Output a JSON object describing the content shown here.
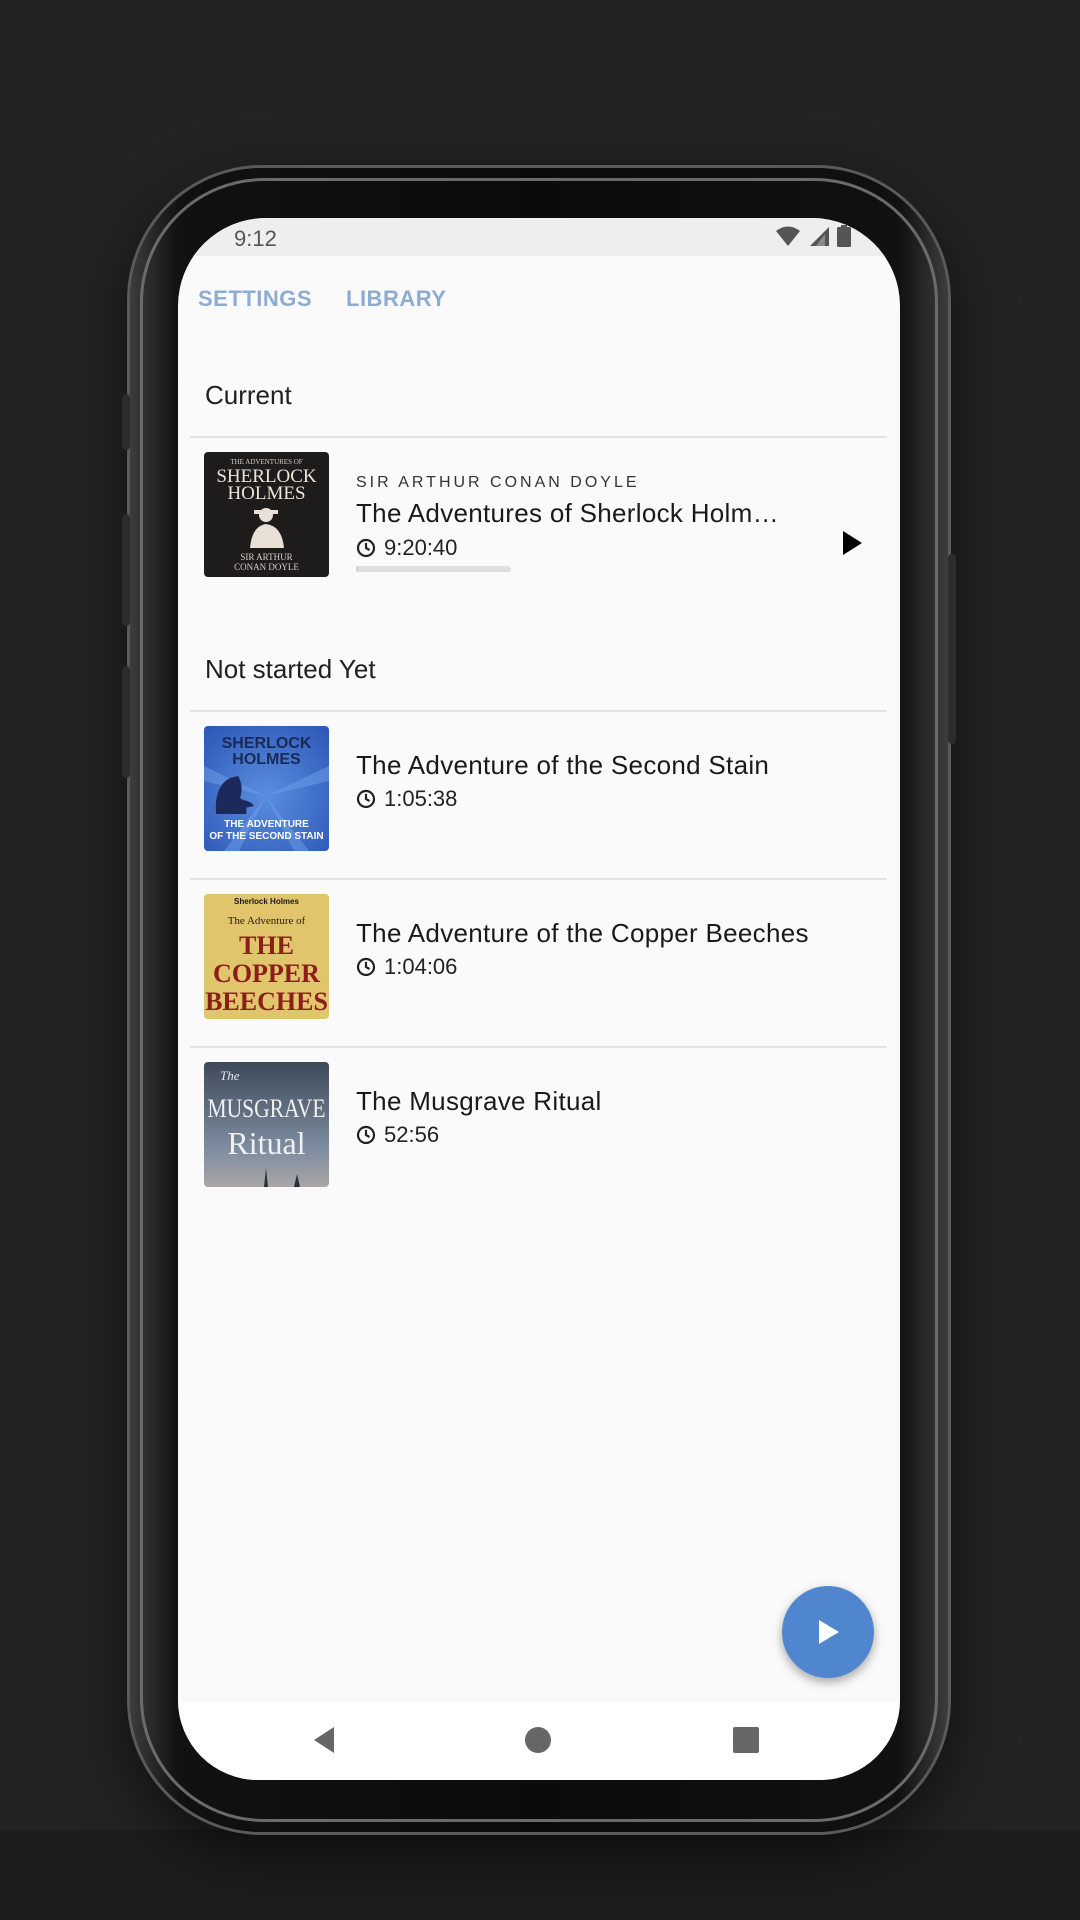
{
  "status_bar": {
    "time": "9:12"
  },
  "tabs": [
    {
      "label": "SETTINGS"
    },
    {
      "label": "LIBRARY"
    }
  ],
  "current_section": {
    "title": "Current",
    "book": {
      "author": "SIR ARTHUR CONAN DOYLE",
      "title": "The Adventures of Sherlock Holm…",
      "duration": "9:20:40",
      "progress": 0.02,
      "cover_text": [
        "THE ADVENTURES OF",
        "SHERLOCK",
        "HOLMES",
        "SIR ARTHUR",
        "CONAN DOYLE"
      ]
    }
  },
  "not_started_section": {
    "title": "Not started Yet",
    "books": [
      {
        "title": "The Adventure of the Second Stain",
        "duration": "1:05:38",
        "cover_text": [
          "SHERLOCK",
          "HOLMES",
          "THE ADVENTURE",
          "OF THE SECOND STAIN"
        ]
      },
      {
        "title": "The Adventure of the Copper Beeches",
        "duration": "1:04:06",
        "cover_text": [
          "Sherlock Holmes",
          "The Adventure of",
          "THE",
          "COPPER",
          "BEECHES"
        ]
      },
      {
        "title": "The Musgrave Ritual",
        "duration": "52:56",
        "cover_text": [
          "The",
          "MUSGRAVE",
          "Ritual"
        ]
      }
    ]
  },
  "colors": {
    "accent": "#4f86cd",
    "tab_text": "#8eacd2",
    "background": "#fafafa"
  },
  "icons": {
    "row_play": "play-icon",
    "fab": "play-icon",
    "duration": "clock-icon",
    "nav": [
      "back-icon",
      "home-icon",
      "recents-icon"
    ]
  }
}
